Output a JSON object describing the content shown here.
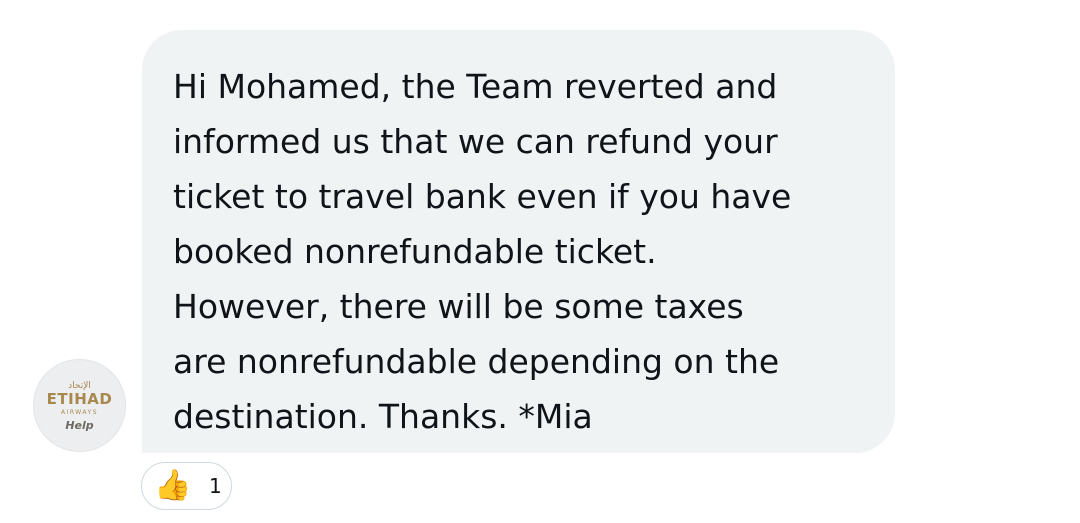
{
  "avatar": {
    "arabic": "الإتحاد",
    "brand": "ETIHAD",
    "sub": "AIRWAYS",
    "help": "Help"
  },
  "message": {
    "lines": [
      "Hi Mohamed, the Team reverted and",
      "informed us that we can refund your",
      "ticket to travel bank even if you have",
      "booked nonrefundable ticket.",
      "However, there will be some taxes",
      "are nonrefundable depending on the",
      "destination. Thanks. *Mia"
    ]
  },
  "reaction": {
    "icon": "thumbs-up-icon",
    "emoji": "👍",
    "count": "1"
  },
  "colors": {
    "bubble": "#eff3f4",
    "text": "#0f1419",
    "brand_gold": "#a8884d"
  }
}
